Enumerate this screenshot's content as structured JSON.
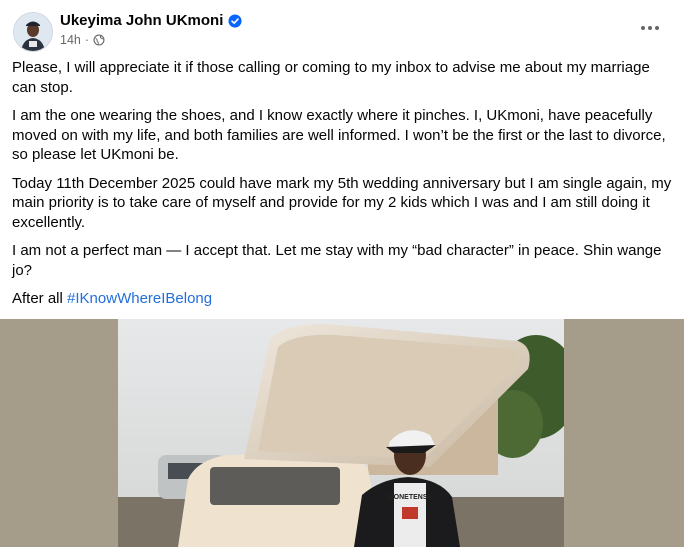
{
  "post": {
    "author": "Ukeyima John UKmoni",
    "time": "14h",
    "separator": "·",
    "paragraphs": [
      "Please, I will appreciate it if those calling or coming to my inbox to advise me about my marriage can stop.",
      "I am the one wearing the shoes, and I know exactly where it pinches. I, UKmoni, have peacefully moved on with my life, and both families are well informed. I won’t be the first or the last to divorce, so please let UKmoni be.",
      "Today 11th December 2025 could have mark my 5th wedding anniversary but I am single again, my main priority is to take care of myself and provide for my 2 kids which I was and I am still doing it excellently.",
      "I am not a perfect man — I accept that. Let me stay with my “bad character” in peace. Shin wange jo?"
    ],
    "closing_text": "After all ",
    "hashtag": "#IKnowWhereIBelong",
    "photo_cap_text": "MONETENSE"
  },
  "icons": {
    "verified": "verified-badge-icon",
    "privacy": "globe-icon",
    "more": "more-options-icon"
  },
  "colors": {
    "link": "#216fdb",
    "secondary_text": "#65676b",
    "verified": "#0866ff",
    "media_background": "#a69c8a"
  }
}
